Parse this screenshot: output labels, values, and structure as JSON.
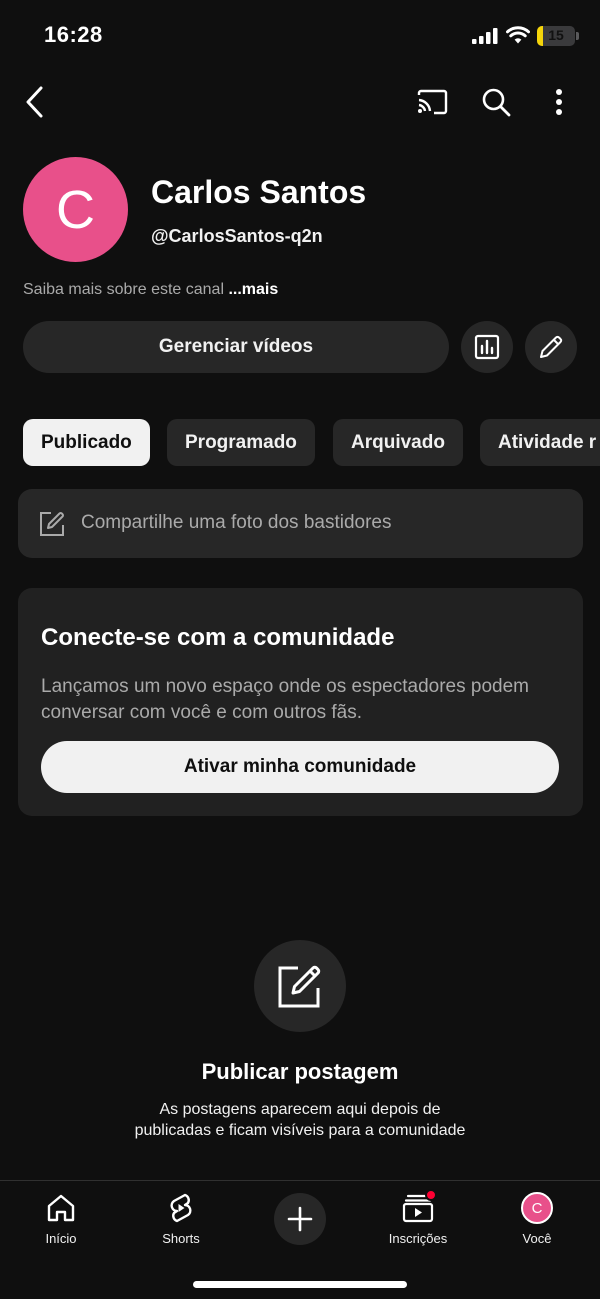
{
  "status_bar": {
    "time": "16:28",
    "battery_level": "15",
    "battery_color": "#f5d50a"
  },
  "top_bar": {
    "icons": [
      "back-arrow-icon",
      "cast-icon",
      "search-icon",
      "more-vert-icon"
    ]
  },
  "channel": {
    "avatar_letter": "C",
    "avatar_color": "#e8508a",
    "name": "Carlos Santos",
    "handle": "@CarlosSantos-q2n",
    "about_text": "Saiba mais sobre este canal",
    "about_more": "...mais"
  },
  "actions": {
    "manage_label": "Gerenciar vídeos",
    "icons": [
      "analytics-icon",
      "edit-pencil-icon"
    ]
  },
  "chips": [
    {
      "label": "Publicado",
      "active": true
    },
    {
      "label": "Programado",
      "active": false
    },
    {
      "label": "Arquivado",
      "active": false
    },
    {
      "label": "Atividade r",
      "active": false
    }
  ],
  "share": {
    "placeholder": "Compartilhe uma foto dos bastidores"
  },
  "community": {
    "title": "Conecte-se com a comunidade",
    "description": "Lançamos um novo espaço onde os espectadores podem conversar com você e com outros fãs.",
    "button_label": "Ativar minha comunidade"
  },
  "empty_state": {
    "title": "Publicar postagem",
    "description": "As postagens aparecem aqui depois de publicadas e ficam visíveis para a comunidade"
  },
  "bottom_nav": {
    "items": [
      {
        "label": "Início",
        "icon": "home-icon"
      },
      {
        "label": "Shorts",
        "icon": "shorts-icon"
      },
      {
        "label": "",
        "icon": "plus-icon"
      },
      {
        "label": "Inscrições",
        "icon": "subscriptions-icon"
      },
      {
        "label": "Você",
        "icon": "avatar-icon",
        "avatar_letter": "C"
      }
    ]
  }
}
